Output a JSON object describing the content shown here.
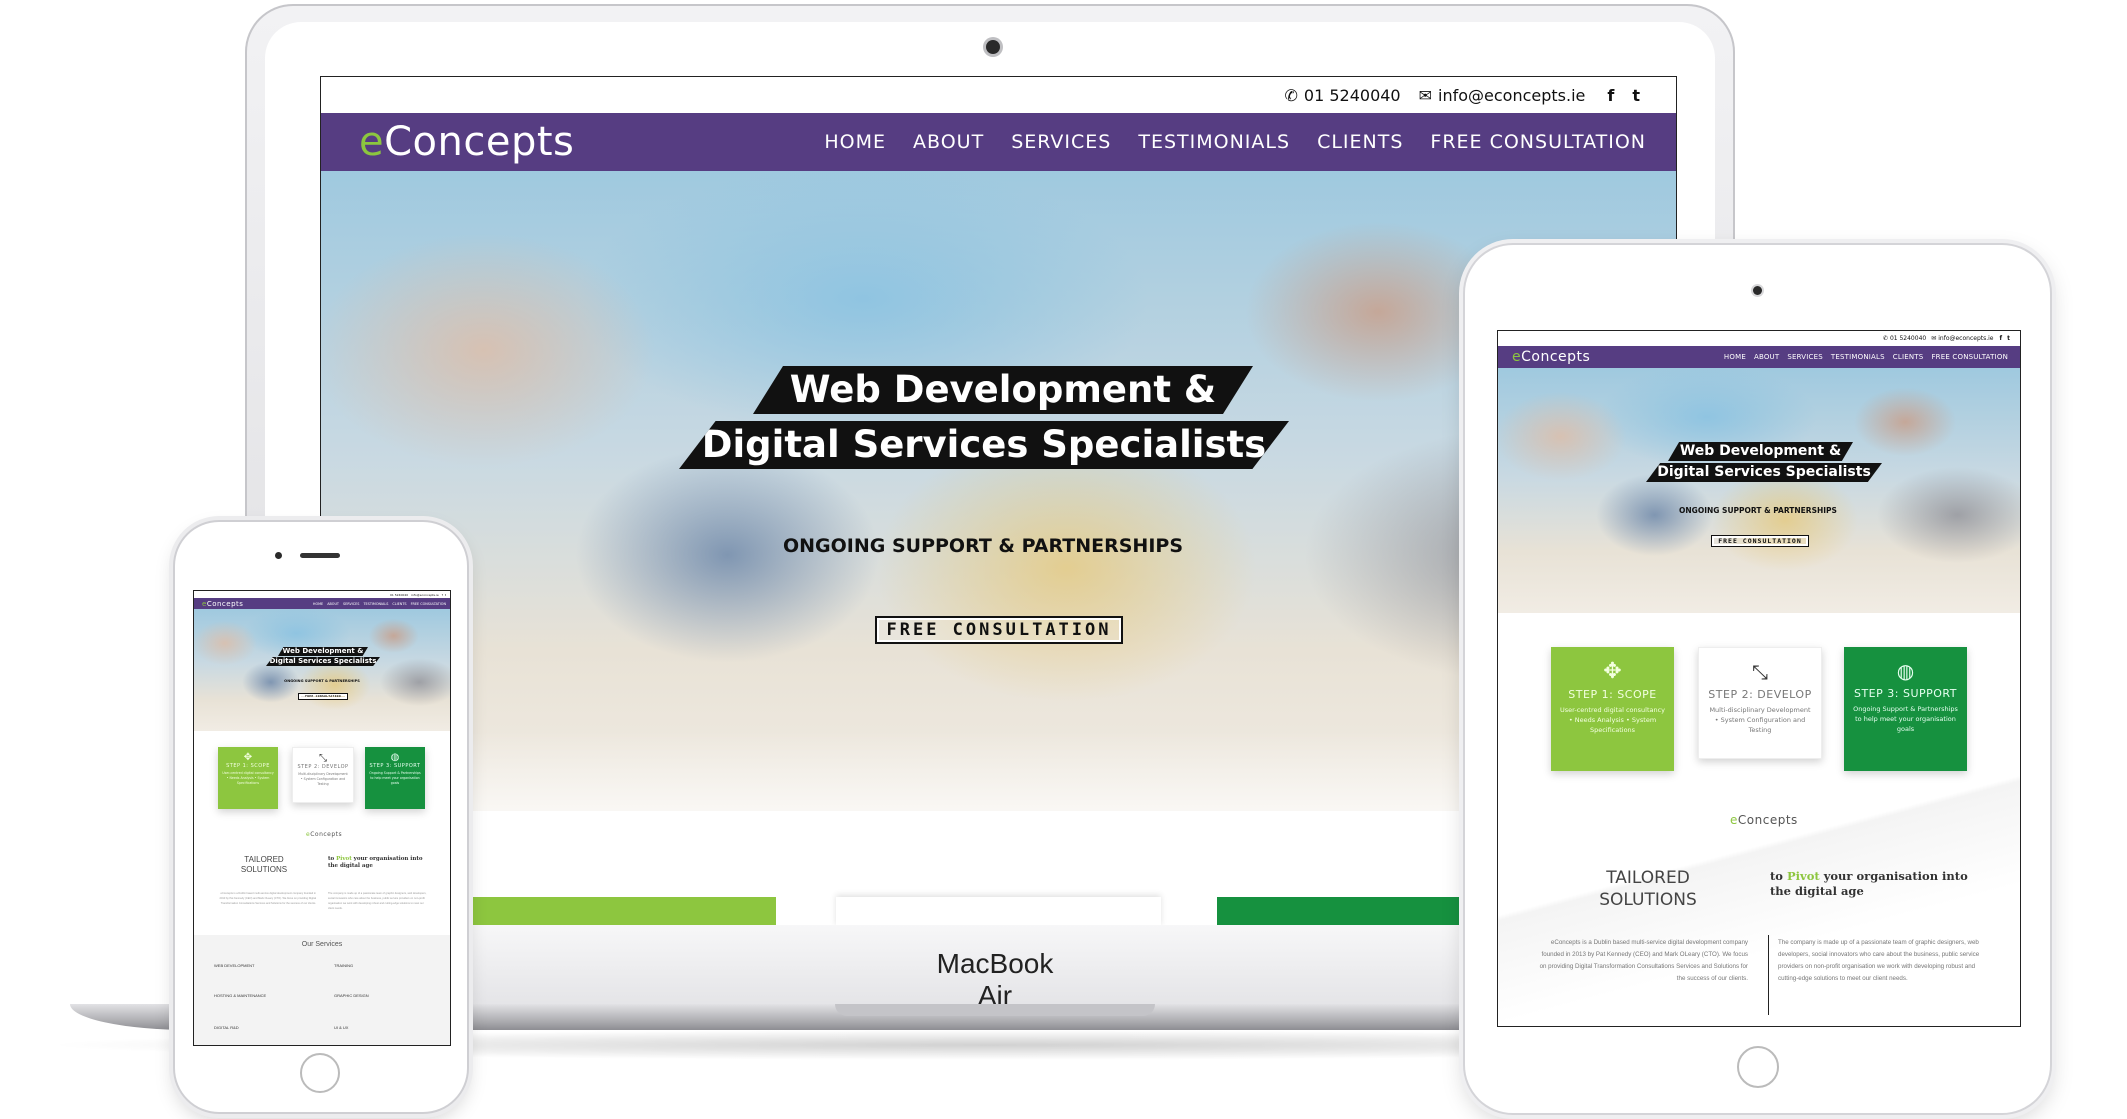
{
  "site": {
    "phone_number": "01 5240040",
    "email": "info@econcepts.ie",
    "logo_prefix": "e",
    "logo_rest": "Concepts",
    "nav": [
      "HOME",
      "ABOUT",
      "SERVICES",
      "TESTIMONIALS",
      "CLIENTS",
      "FREE CONSULTATION"
    ],
    "hero_line1": "Web Development &",
    "hero_line2": "Digital Services Specialists",
    "hero_sub": "ONGOING SUPPORT & PARTNERSHIPS",
    "hero_button": "FREE CONSULTATION",
    "steps": [
      {
        "title": "STEP 1: SCOPE",
        "desc": "User-centred digital consultancy • Needs Analysis • System Specifications"
      },
      {
        "title": "STEP 2: DEVELOP",
        "desc": "Multi-disciplinary Development • System Configuration and Testing"
      },
      {
        "title": "STEP 3: SUPPORT",
        "desc": "Ongoing Support & Partnerships to help meet your organisation goals"
      }
    ],
    "tailored_line1": "TAILORED",
    "tailored_line2": "SOLUTIONS",
    "pivot_pre": "to ",
    "pivot_word": "Pivot",
    "pivot_post": " your organisation into the digital age",
    "about_left": "eConcepts is a Dublin based multi-service digital development company founded in 2013 by Pat Kennedy (CEO) and Mark OLeary (CTO). We focus on providing Digital Transformation Consultations Services and Solutions for the success of our clients.",
    "about_right": "The company is made up of a passionate team of graphic designers, web developers, social innovators who care about the business, public service providers on non-profit organisation we work with developing robust and cutting-edge solutions to meet our client needs.",
    "services_title": "Our Services",
    "services": [
      "WEB DEVELOPMENT",
      "TRAINING",
      "HOSTING & MAINTENANCE",
      "GRAPHIC DESIGN",
      "DIGITAL R&D",
      "UI & UX"
    ]
  },
  "devices": {
    "laptop_label": "MacBook Air"
  },
  "icons": {
    "phone": "phone-icon",
    "email": "envelope-icon",
    "facebook": "facebook-icon",
    "twitter": "twitter-icon",
    "scope": "move-arrows-icon",
    "develop": "resize-icon",
    "support": "globe-icon"
  },
  "colors": {
    "nav_purple": "#563d82",
    "green_light": "#8dc63f",
    "green_dark": "#16913f",
    "banner_black": "#111111"
  }
}
